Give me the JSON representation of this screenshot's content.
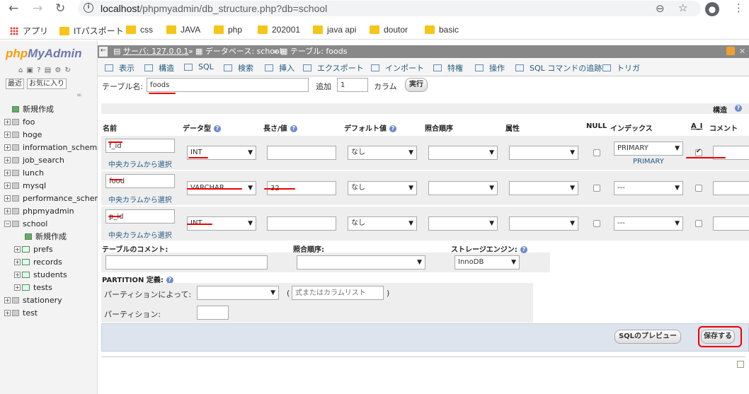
{
  "browser": {
    "url_host": "localhost",
    "url_path": "/phpmyadmin/db_structure.php?db=school",
    "bookmarks": [
      "アプリ",
      "ITパスポート",
      "css",
      "JAVA",
      "php",
      "202001",
      "java api",
      "doutor",
      "basic"
    ]
  },
  "sidebar": {
    "logo_php": "php",
    "logo_myadmin": "MyAdmin",
    "tab_recent": "最近",
    "tab_favorites": "お気に入り",
    "tree": [
      {
        "label": "新規作成",
        "type": "new"
      },
      {
        "label": "foo",
        "type": "db"
      },
      {
        "label": "hoge",
        "type": "db"
      },
      {
        "label": "information_schema",
        "type": "db"
      },
      {
        "label": "job_search",
        "type": "db"
      },
      {
        "label": "lunch",
        "type": "db"
      },
      {
        "label": "mysql",
        "type": "db"
      },
      {
        "label": "performance_schema",
        "type": "db"
      },
      {
        "label": "phpmyadmin",
        "type": "db"
      },
      {
        "label": "school",
        "type": "db-open"
      },
      {
        "label": "新規作成",
        "type": "new-child"
      },
      {
        "label": "prefs",
        "type": "table"
      },
      {
        "label": "records",
        "type": "table"
      },
      {
        "label": "students",
        "type": "table"
      },
      {
        "label": "tests",
        "type": "table"
      },
      {
        "label": "stationery",
        "type": "db"
      },
      {
        "label": "test",
        "type": "db"
      }
    ]
  },
  "breadcrumb": {
    "server": "サーバ: 127.0.0.1",
    "database": "データベース: school",
    "table": "テーブル: foods"
  },
  "menu": [
    "表示",
    "構造",
    "SQL",
    "検索",
    "挿入",
    "エクスポート",
    "インポート",
    "特権",
    "操作",
    "SQL コマンドの追跡",
    "トリガ"
  ],
  "form": {
    "table_name_label": "テーブル名:",
    "table_name": "foods",
    "add_label": "追加",
    "add_count": "1",
    "column_label": "カラム",
    "go_button": "実行",
    "structure_label": "構造"
  },
  "headers": {
    "name": "名前",
    "type": "データ型",
    "length": "長さ/値",
    "default": "デフォルト値",
    "collation": "照合順序",
    "attributes": "属性",
    "null": "NULL",
    "index": "インデックス",
    "ai": "A_I",
    "comment": "コメント"
  },
  "select_central": "中央カラムから選択",
  "fields": [
    {
      "name": "f_id",
      "type": "INT",
      "length": "",
      "default": "なし",
      "index": "PRIMARY",
      "index_note": "PRIMARY",
      "ai": true
    },
    {
      "name": "food",
      "type": "VARCHAR",
      "length": "32",
      "default": "なし",
      "index": "---",
      "index_note": "",
      "ai": false
    },
    {
      "name": "p_id",
      "type": "INT",
      "length": "",
      "default": "なし",
      "index": "---",
      "index_note": "",
      "ai": false
    }
  ],
  "table_opts": {
    "comment_label": "テーブルのコメント:",
    "collation_label": "照合順序:",
    "engine_label": "ストレージエンジン:",
    "engine_value": "InnoDB",
    "partition_label": "PARTITION 定義:",
    "partition_by_label": "パーティションによって:",
    "partition_expr_placeholder": "式またはカラムリスト",
    "partitions_label": "パーティション:"
  },
  "buttons": {
    "preview": "SQLのプレビュー",
    "save": "保存する"
  }
}
